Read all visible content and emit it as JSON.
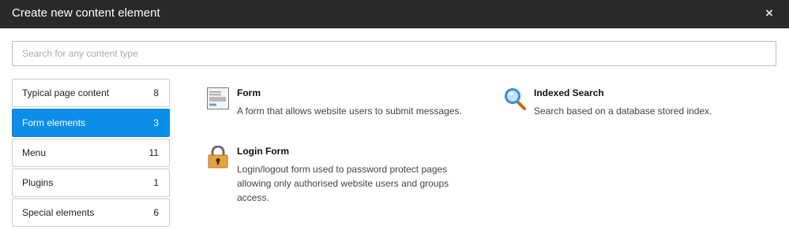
{
  "dialog": {
    "title": "Create new content element",
    "close_symbol": "×"
  },
  "search": {
    "placeholder": "Search for any content type",
    "value": ""
  },
  "tabs": [
    {
      "label": "Typical page content",
      "count": "8",
      "active": false
    },
    {
      "label": "Form elements",
      "count": "3",
      "active": true
    },
    {
      "label": "Menu",
      "count": "11",
      "active": false
    },
    {
      "label": "Plugins",
      "count": "1",
      "active": false
    },
    {
      "label": "Special elements",
      "count": "6",
      "active": false
    }
  ],
  "items": [
    {
      "title": "Form",
      "description": "A form that allows website users to submit messages.",
      "icon": "form-icon"
    },
    {
      "title": "Indexed Search",
      "description": "Search based on a database stored index.",
      "icon": "magnifier-icon"
    },
    {
      "title": "Login Form",
      "description": "Login/logout form used to password protect pages allowing only authorised website users and groups access.",
      "icon": "padlock-icon"
    }
  ],
  "colors": {
    "header_bg": "#292929",
    "active_tab": "#0b8ee9",
    "lock_body": "#e8a33a",
    "magnifier": "#3a8fd8"
  }
}
